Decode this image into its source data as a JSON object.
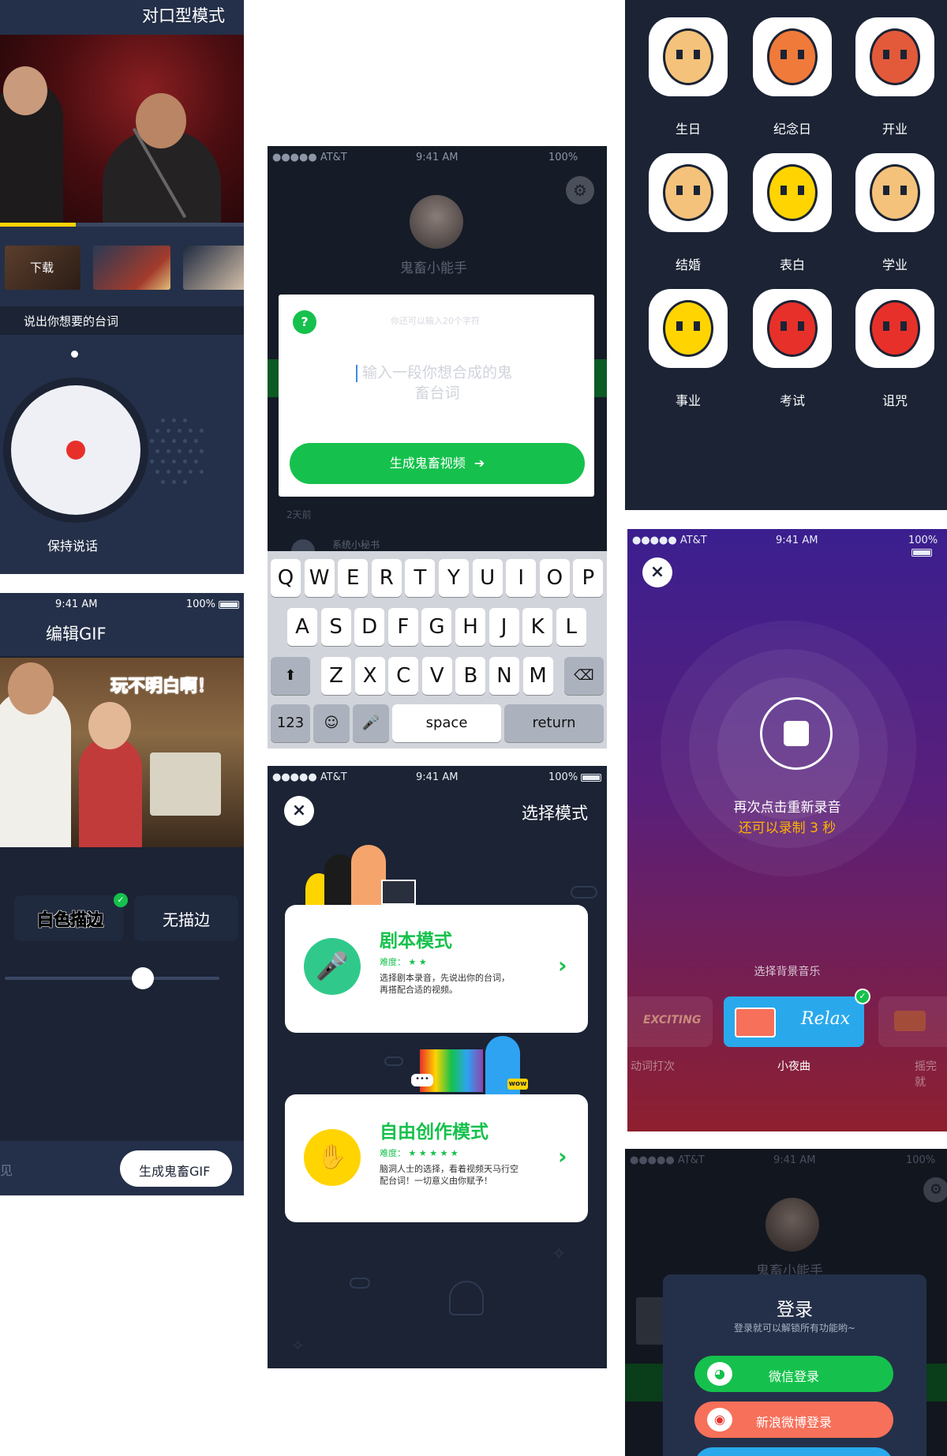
{
  "colors": {
    "dark_bg": "#1b2334",
    "navy_bg": "#243049",
    "green": "#15c14c",
    "yellow": "#ffd400",
    "record_red": "#e8302a",
    "purple_top": "#3b1f8f",
    "purple_bottom": "#8e1f2f",
    "relax_blue": "#29a9ec",
    "weibo_coral": "#f7705a",
    "highlight_yellow": "#ffb400"
  },
  "status": {
    "carrier": "●●●●● AT&T",
    "time": "9:41 AM",
    "battery": "100%"
  },
  "panel_duet": {
    "title": "对口型模式",
    "download_label": "下载",
    "prompt": "说出你想要的台词",
    "hold_hint": "保持说话"
  },
  "panel_gif": {
    "title": "编辑GIF",
    "caption": "玩不明白啊！",
    "option_white": "白色描边",
    "option_none": "无描边",
    "left_hint": "见",
    "generate_label": "生成鬼畜GIF"
  },
  "panel_input": {
    "username": "鬼畜小能手",
    "char_limit_hint": "你还可以输入20个字符",
    "placeholder": "输入一段你想合成的鬼畜台词",
    "generate_label": "生成鬼畜视频",
    "timestamp": "2天前",
    "system_name": "系统小秘书",
    "help_icon_text": "?"
  },
  "keyboard": {
    "row1": [
      "Q",
      "W",
      "E",
      "R",
      "T",
      "Y",
      "U",
      "I",
      "O",
      "P"
    ],
    "row2": [
      "A",
      "S",
      "D",
      "F",
      "G",
      "H",
      "J",
      "K",
      "L"
    ],
    "row3": [
      "Z",
      "X",
      "C",
      "V",
      "B",
      "N",
      "M"
    ],
    "num_key": "123",
    "space_key": "space",
    "return_key": "return"
  },
  "panel_mode": {
    "title": "选择模式",
    "mode_script": {
      "title": "剧本模式",
      "difficulty_label": "难度：",
      "stars": "★ ★",
      "desc_line1": "选择剧本录音，先说出你的台词，",
      "desc_line2": "再搭配合适的视频。"
    },
    "mode_free": {
      "title": "自由创作模式",
      "difficulty_label": "难度：",
      "stars": "★ ★ ★ ★ ★",
      "desc_line1": "脑洞人士的选择，看着视频天马行空",
      "desc_line2": "配台词！一切意义由你赋予！"
    },
    "sticker_wow": "wow",
    "sticker_dots": "•••"
  },
  "panel_occasions": {
    "items": [
      {
        "label": "生日",
        "icon": "old-man-glasses-icon"
      },
      {
        "label": "纪念日",
        "icon": "ginger-woman-icon"
      },
      {
        "label": "开业",
        "icon": "boss-face-icon"
      },
      {
        "label": "结婚",
        "icon": "groom-rose-icon"
      },
      {
        "label": "表白",
        "icon": "shy-girl-heart-icon"
      },
      {
        "label": "学业",
        "icon": "student-boy-icon"
      },
      {
        "label": "事业",
        "icon": "glasses-worker-icon"
      },
      {
        "label": "考试",
        "icon": "scarf-student-icon"
      },
      {
        "label": "诅咒",
        "icon": "red-devil-icon"
      }
    ]
  },
  "panel_record": {
    "rerecord_hint": "再次点击重新录音",
    "remaining_hint": "还可以录制 3 秒",
    "bgm_title": "选择背景音乐",
    "tracks": [
      {
        "title": "EXCITING",
        "subtitle": "动词打次"
      },
      {
        "title": "Relax",
        "subtitle": "小夜曲"
      },
      {
        "title": "",
        "subtitle": "摇完就"
      }
    ]
  },
  "panel_login": {
    "username": "鬼畜小能手",
    "title": "登录",
    "subtitle": "登录就可以解锁所有功能哟~",
    "wechat_label": "微信登录",
    "weibo_label": "新浪微博登录"
  }
}
